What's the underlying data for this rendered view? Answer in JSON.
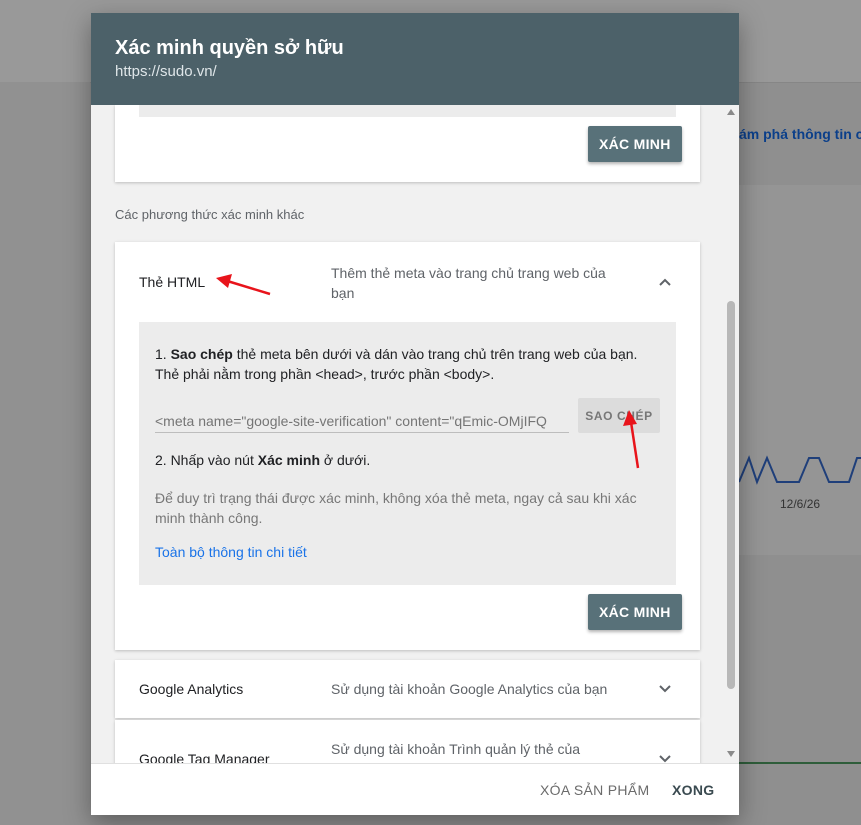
{
  "background": {
    "link_text": "ám phá thông tin c",
    "date_label": "12/6/26"
  },
  "modal": {
    "title": "Xác minh quyền sở hữu",
    "url": "https://sudo.vn/"
  },
  "top_card": {
    "verify_label": "XÁC MINH"
  },
  "other_methods_label": "Các phương thức xác minh khác",
  "html_tag_method": {
    "name": "Thẻ HTML",
    "description": "Thêm thẻ meta vào trang chủ trang web của bạn",
    "step1_bold": "Sao chép",
    "step1_text_a": " thẻ meta bên dưới và dán vào trang chủ trên trang web của bạn. Thẻ phải nằm trong phần <head>, trước phần <body>.",
    "meta_value": "<meta name=\"google-site-verification\" content=\"qEmic-OMjIFQ",
    "copy_label": "SAO CHÉP",
    "step2_prefix": "2. Nhấp vào nút ",
    "step2_bold": "Xác minh",
    "step2_suffix": " ở dưới.",
    "note": "Để duy trì trạng thái được xác minh, không xóa thẻ meta, ngay cả sau khi xác minh thành công.",
    "details_link": "Toàn bộ thông tin chi tiết",
    "verify_label": "XÁC MINH",
    "step1_prefix": "1. "
  },
  "google_analytics": {
    "name": "Google Analytics",
    "description": "Sử dụng tài khoản Google Analytics của bạn"
  },
  "google_tag_manager": {
    "name": "Google Tag Manager",
    "description": "Sử dụng tài khoản Trình quản lý thẻ của"
  },
  "footer": {
    "remove_label": "XÓA SẢN PHẨM",
    "done_label": "XONG"
  },
  "colors": {
    "header_bg": "#4c6169",
    "primary_button": "#587179",
    "link": "#1a73e8",
    "annotation_arrow": "#e8141b"
  }
}
